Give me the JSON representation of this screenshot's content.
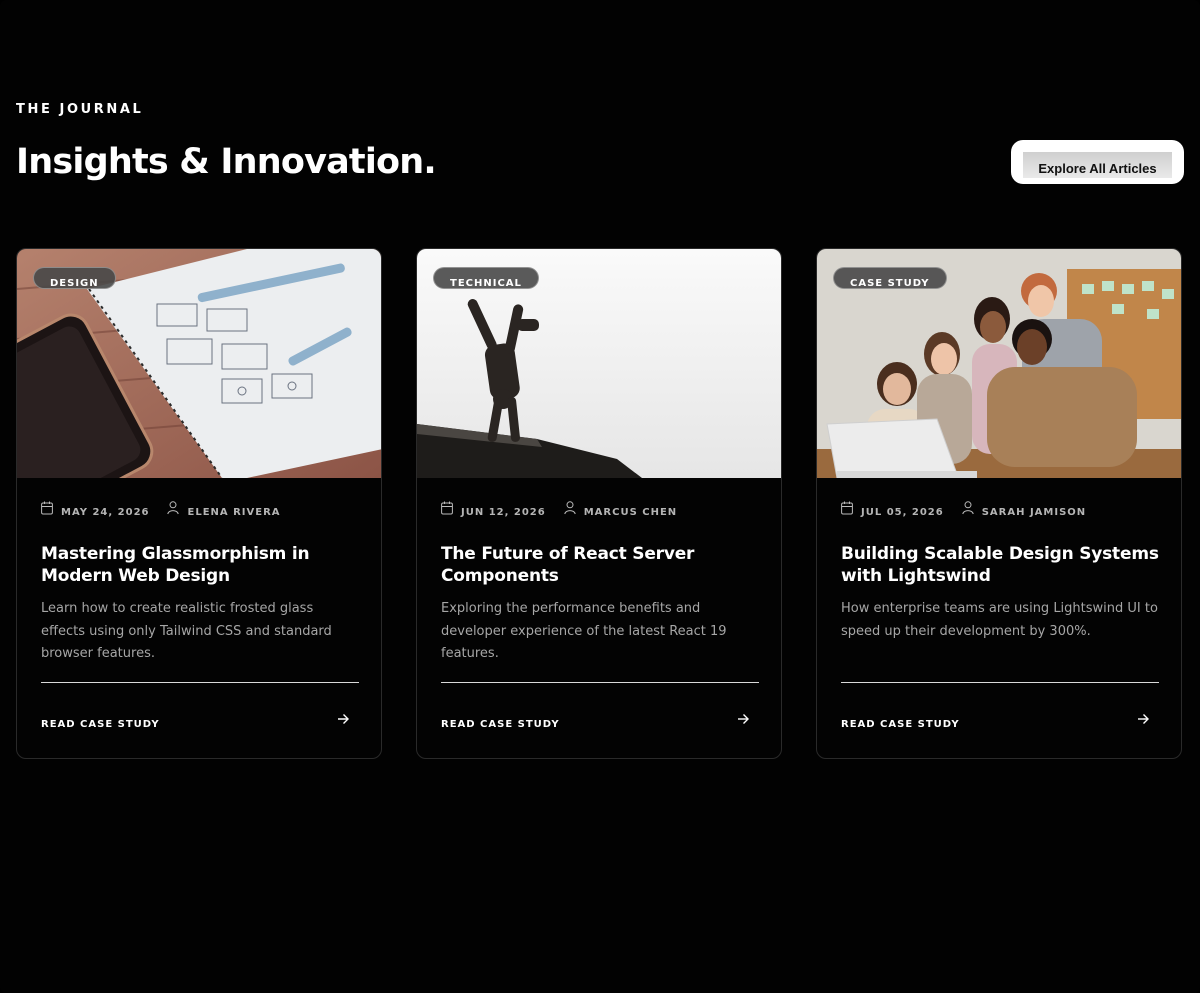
{
  "section": {
    "eyebrow": "THE JOURNAL",
    "title": "Insights & Innovation.",
    "cta_label": "Explore All Articles"
  },
  "icons": {
    "date": "calendar-icon",
    "author": "user-icon",
    "link": "arrow-right-icon"
  },
  "colors": {
    "background": "#020202",
    "card_border": "#2a2a2a",
    "meta_text": "#b5b5b5",
    "excerpt_text": "#a6a6a6",
    "button_bg": "#ffffff"
  },
  "articles": [
    {
      "category": "DESIGN",
      "date": "MAY 24, 2026",
      "author": "ELENA RIVERA",
      "title": "Mastering Glassmorphism in Modern Web Design",
      "excerpt": "Learn how to create realistic frosted glass effects using only Tailwind CSS and standard browser features.",
      "link_label": "READ CASE STUDY"
    },
    {
      "category": "TECHNICAL",
      "date": "JUN 12, 2026",
      "author": "MARCUS CHEN",
      "title": "The Future of React Server Components",
      "excerpt": "Exploring the performance benefits and developer experience of the latest React 19 features.",
      "link_label": "READ CASE STUDY"
    },
    {
      "category": "CASE STUDY",
      "date": "JUL 05, 2026",
      "author": "SARAH JAMISON",
      "title": "Building Scalable Design Systems with Lightswind",
      "excerpt": "How enterprise teams are using Lightswind UI to speed up their development by 300%.",
      "link_label": "READ CASE STUDY"
    }
  ]
}
